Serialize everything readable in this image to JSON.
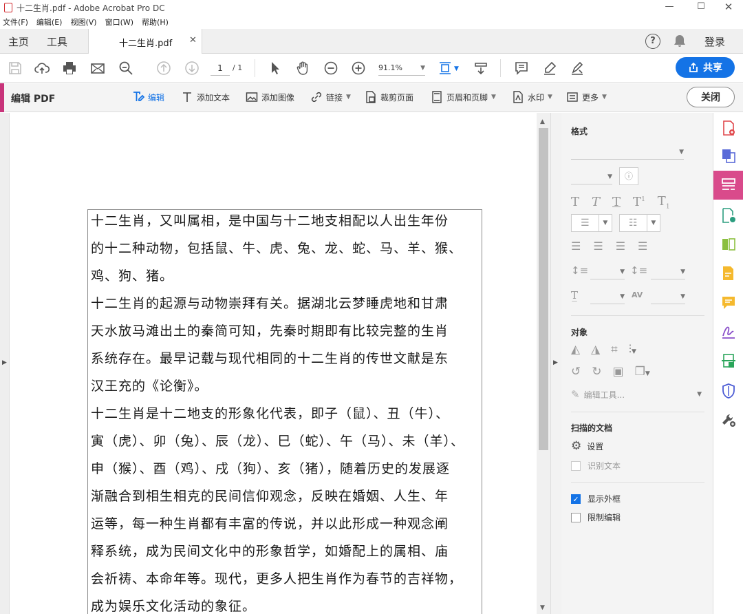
{
  "window": {
    "title": "十二生肖.pdf - Adobe Acrobat Pro DC"
  },
  "menu": [
    "文件(F)",
    "编辑(E)",
    "视图(V)",
    "窗口(W)",
    "帮助(H)"
  ],
  "tabs": {
    "home": "主页",
    "tools": "工具",
    "document": "十二生肖.pdf"
  },
  "account": {
    "signin": "登录"
  },
  "toolbar": {
    "page_current": "1",
    "page_total": "/ 1",
    "zoom": "91.1%",
    "share": "共享"
  },
  "editbar": {
    "title": "编辑 PDF",
    "tools": [
      "编辑",
      "添加文本",
      "添加图像",
      "链接",
      "裁剪页面",
      "页眉和页脚",
      "水印",
      "更多"
    ],
    "close": "关闭"
  },
  "document": {
    "lines": [
      "十二生肖，又叫属相，是中国与十二地支相配以人出生年份",
      "的十二种动物，包括鼠、牛、虎、兔、龙、蛇、马、羊、猴、",
      "鸡、狗、猪。",
      "十二生肖的起源与动物崇拜有关。据湖北云梦睡虎地和甘肃",
      "天水放马滩出土的秦简可知，先秦时期即有比较完整的生肖",
      "系统存在。最早记载与现代相同的十二生肖的传世文献是东",
      "汉王充的《论衡》。",
      "十二生肖是十二地支的形象化代表，即子（鼠）、丑（牛）、",
      "寅（虎）、卯（兔）、辰（龙）、巳（蛇）、午（马）、未（羊）、",
      "申（猴）、酉（鸡）、戌（狗）、亥（猪），随着历史的发展逐",
      "渐融合到相生相克的民间信仰观念，反映在婚姻、人生、年",
      "运等，每一种生肖都有丰富的传说，并以此形成一种观念阐",
      "释系统，成为民间文化中的形象哲学，如婚配上的属相、庙",
      "会祈祷、本命年等。现代，更多人把生肖作为春节的吉祥物，",
      "成为娱乐文化活动的象征。"
    ]
  },
  "panel": {
    "format_title": "格式",
    "objects_title": "对象",
    "edit_tool": "编辑工具...",
    "scanned_title": "扫描的文档",
    "settings": "设置",
    "recognize_text": "识别文本",
    "show_bbox": "显示外框",
    "restrict_edit": "限制编辑"
  },
  "colors": {
    "accent_pink": "#d94a8b",
    "share_blue": "#1473e6"
  }
}
